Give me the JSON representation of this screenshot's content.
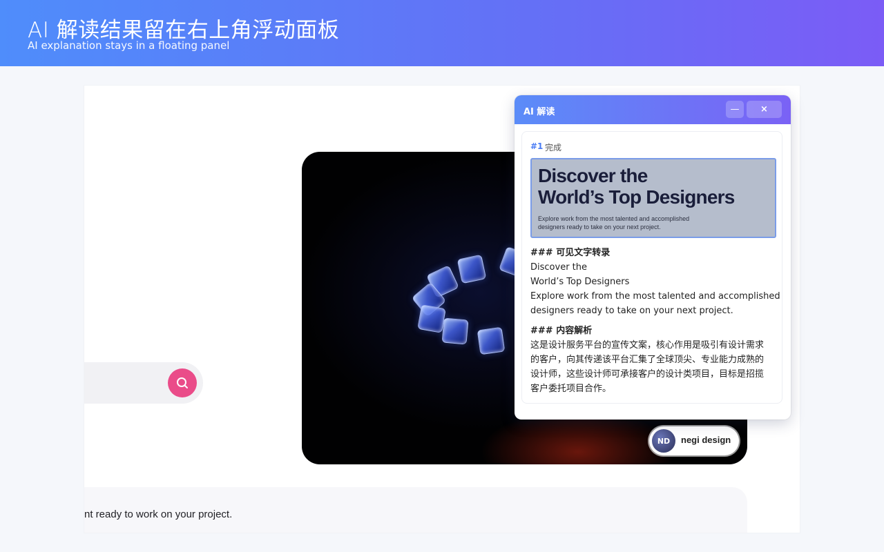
{
  "banner": {
    "title": "AI 解读结果留在右上角浮动面板",
    "subtitle": "AI explanation stays in a floating panel"
  },
  "page": {
    "bottom_text": "nt ready to work on your project.",
    "author_name": "negi design",
    "author_avatar_text": "ND",
    "search_accent": "#ea4c89"
  },
  "ai_panel": {
    "title": "AI 解读",
    "minimize_label": "—",
    "close_label": "×",
    "result_number": "#1",
    "result_status": "完成",
    "thumbnail": {
      "heading_line1": "Discover the",
      "heading_line2": "World’s Top Designers",
      "sub_line1": "Explore work from the most talented and accomplished",
      "sub_line2": "designers ready to take on your next project."
    },
    "transcript_heading": "### 可见文字转录",
    "transcript_lines": [
      "Discover the",
      "World’s Top Designers",
      "Explore work from the most talented and accomplished",
      "designers ready to take on your next project."
    ],
    "analysis_heading": "### 内容解析",
    "analysis_lines": [
      "这是设计服务平台的宣传文案，核心作用是吸引有设计需求",
      "的客户，向其传递该平台汇集了全球顶尖、专业能力成熟的",
      "设计师，这些设计师可承接客户的设计类项目，目标是招揽",
      "客户委托项目合作。"
    ]
  },
  "colors": {
    "banner_start": "#4f8dfb",
    "banner_end": "#7b5cf6",
    "panel_accent": "#4a7cf4"
  }
}
